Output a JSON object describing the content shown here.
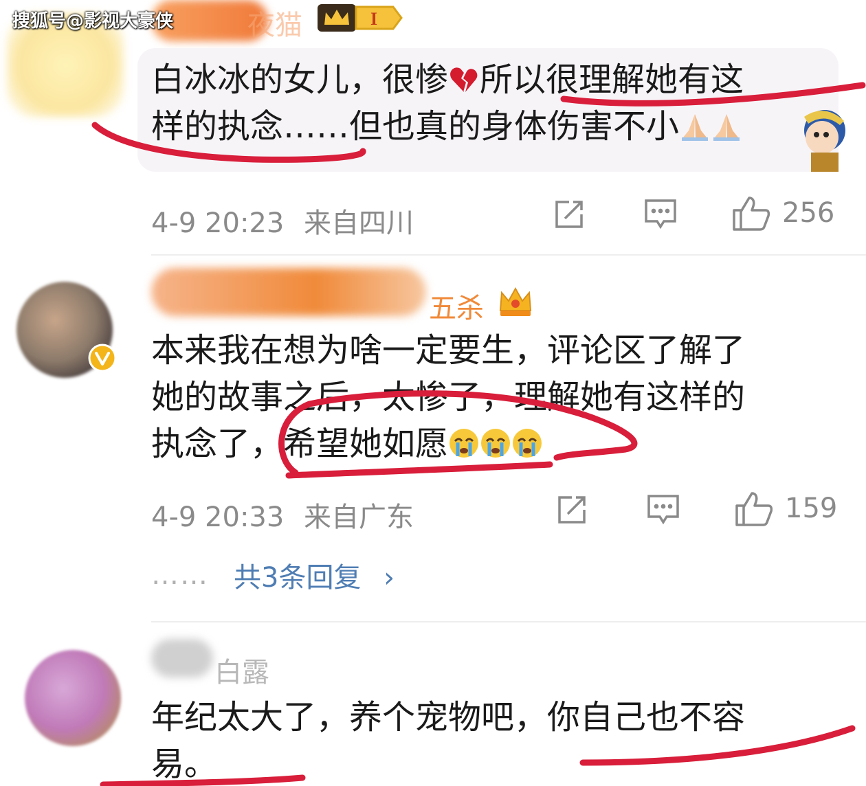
{
  "watermark": "搜狐号@影视大豪侠",
  "comments": [
    {
      "username_visible": "夜猫",
      "text_lines": [
        "白冰冰的女儿，很惨",
        "所以很理解她有这",
        "样的执念……但也真的身体伤害不小"
      ],
      "time": "4-9 20:23",
      "location": "来自四川",
      "likes": "256"
    },
    {
      "username_visible": "五杀",
      "text_lines": [
        "本来我在想为啥一定要生，评论区了解了",
        "她的故事之后，太惨了，理解她有这样的",
        "执念了，希望她如愿"
      ],
      "time": "4-9 20:33",
      "location": "来自广东",
      "likes": "159",
      "replies_dots": "……",
      "replies_label": "共3条回复",
      "replies_chevron": "›"
    },
    {
      "username_visible": "白露",
      "text_lines": [
        "年纪太大了，养个宠物吧，你自己也不容",
        "易。"
      ]
    }
  ],
  "icons": {
    "share": "share-icon",
    "comment": "comment-icon",
    "like": "thumbs-up-icon",
    "heart": "broken-heart-emoji",
    "pray": "praying-hands-emoji",
    "cry": "crying-face-emoji",
    "crown": "crown-badge-icon"
  },
  "colors": {
    "username": "#f08a3a",
    "link": "#4f7db3",
    "meta": "#8a8a8a",
    "annotation": "#d81e3a"
  }
}
